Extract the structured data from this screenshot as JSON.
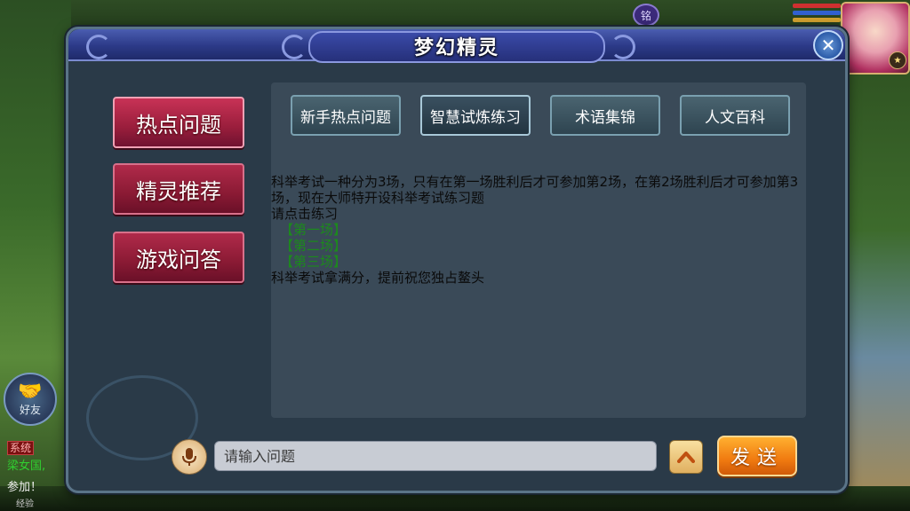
{
  "hud": {
    "map_badge": "铭",
    "friend_label": "好友",
    "chat": {
      "sys_tag": "系统",
      "line1": "梁女国,",
      "line2": "参加！"
    },
    "level_text": "经验"
  },
  "dialog": {
    "title": "梦幻精灵",
    "close_glyph": "✕"
  },
  "menu": {
    "items": [
      {
        "label": "热点问题"
      },
      {
        "label": "精灵推荐"
      },
      {
        "label": "游戏问答"
      }
    ]
  },
  "tabs": [
    {
      "label": "新手热点问题"
    },
    {
      "label": "智慧试炼练习"
    },
    {
      "label": "术语集锦"
    },
    {
      "label": "人文百科"
    }
  ],
  "content": {
    "para1": "科举考试一种分为3场，只有在第一场胜利后才可参加第2场，在第2场胜利后才可参加第3场，现在大师特开设科举考试练习题",
    "prompt": "请点击练习",
    "links": [
      "【第一场】",
      "【第二场】",
      "【第三场】"
    ],
    "closing": "科举考试拿满分，提前祝您独占鳌头"
  },
  "input": {
    "placeholder": "请输入问题"
  },
  "send_label": "发送",
  "icons": {
    "mic": "microphone-icon",
    "up": "chevron-up-icon",
    "close": "close-icon",
    "friend": "handshake-icon"
  },
  "colors": {
    "menu_red": "#9a1e3c",
    "title_blue": "#2c3a88",
    "link_green": "#1c8a1c",
    "send_orange": "#f07a10"
  }
}
